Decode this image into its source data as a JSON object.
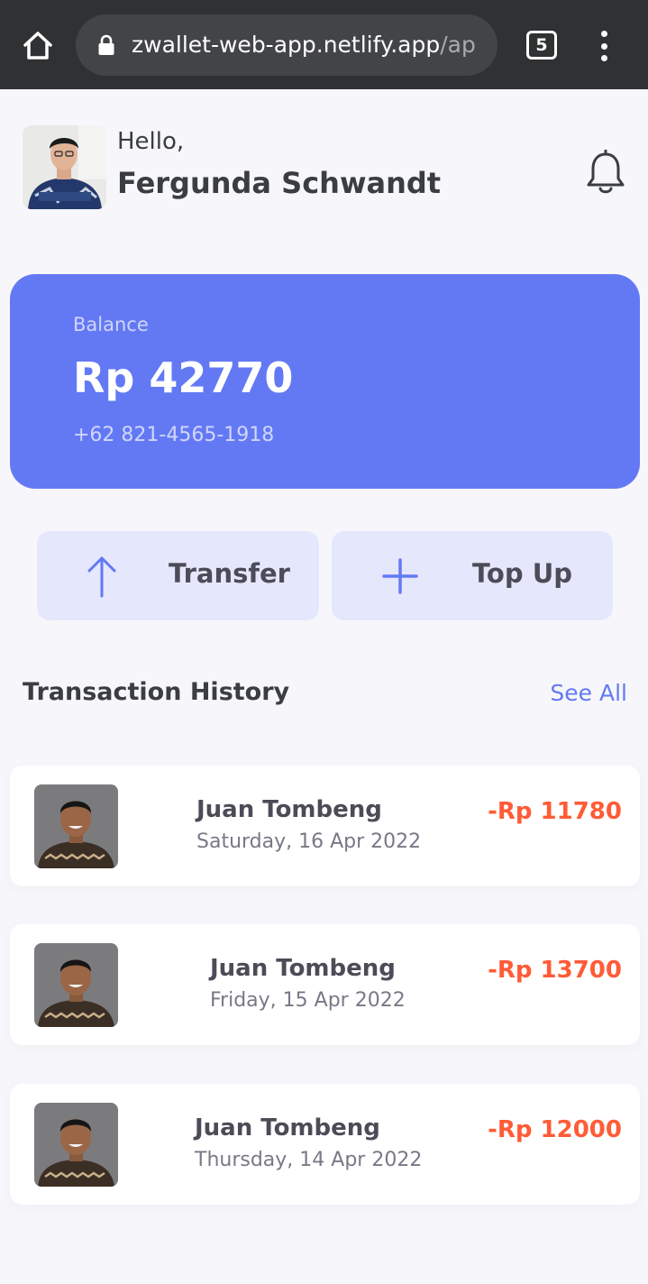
{
  "browser": {
    "url_main": "zwallet-web-app.netlify.app",
    "url_rest": "/ap",
    "tab_count": "5"
  },
  "header": {
    "greeting": "Hello,",
    "user_name": "Fergunda Schwandt"
  },
  "balance": {
    "label": "Balance",
    "amount": "Rp 42770",
    "phone": "+62 821-4565-1918"
  },
  "actions": {
    "transfer_label": "Transfer",
    "topup_label": "Top Up"
  },
  "history": {
    "title": "Transaction History",
    "see_all": "See All",
    "items": [
      {
        "name": "Juan Tombeng",
        "date": "Saturday, 16 Apr 2022",
        "amount": "-Rp 11780"
      },
      {
        "name": "Juan Tombeng",
        "date": "Friday, 15 Apr 2022",
        "amount": "-Rp 13700"
      },
      {
        "name": "Juan Tombeng",
        "date": "Thursday, 14 Apr 2022",
        "amount": "-Rp 12000"
      }
    ]
  },
  "colors": {
    "primary": "#6379f4",
    "negative": "#ff5b37",
    "button_bg": "#e5e8fc"
  },
  "icons": {
    "home": "home-icon",
    "lock": "lock-icon",
    "menu": "more-vert-icon",
    "bell": "bell-icon",
    "transfer": "arrow-up-icon",
    "topup": "plus-icon"
  }
}
